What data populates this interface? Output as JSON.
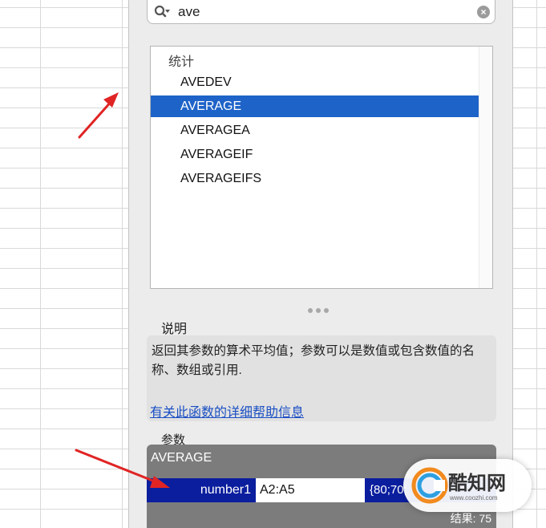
{
  "search": {
    "query": "ave"
  },
  "function_list": {
    "category": "统计",
    "items": [
      "AVEDEV",
      "AVERAGE",
      "AVERAGEA",
      "AVERAGEIF",
      "AVERAGEIFS"
    ],
    "selected": "AVERAGE"
  },
  "description": {
    "label": "说明",
    "text": "返回其参数的算术平均值；参数可以是数值或包含数值的名称、数组或引用.",
    "help_link": "有关此函数的详细帮助信息"
  },
  "arguments": {
    "label": "参数",
    "function_name": "AVERAGE",
    "rows": [
      {
        "name": "number1",
        "value": "A2:A5",
        "evaluated": "{80;70;"
      }
    ],
    "result": "结果: 75"
  },
  "watermark": {
    "name": "酷知网",
    "url": "www.coozhi.com"
  },
  "colors": {
    "selection": "#1e63c8",
    "arg_row": "#0a1e9e",
    "args_panel": "#7c7c7c",
    "link": "#1a4fc4",
    "annotation_arrow": "#e02424"
  },
  "icons": {
    "search": "magnifier-dropdown-icon",
    "clear": "clear-circle-icon",
    "grip": "resize-grip-icon"
  }
}
